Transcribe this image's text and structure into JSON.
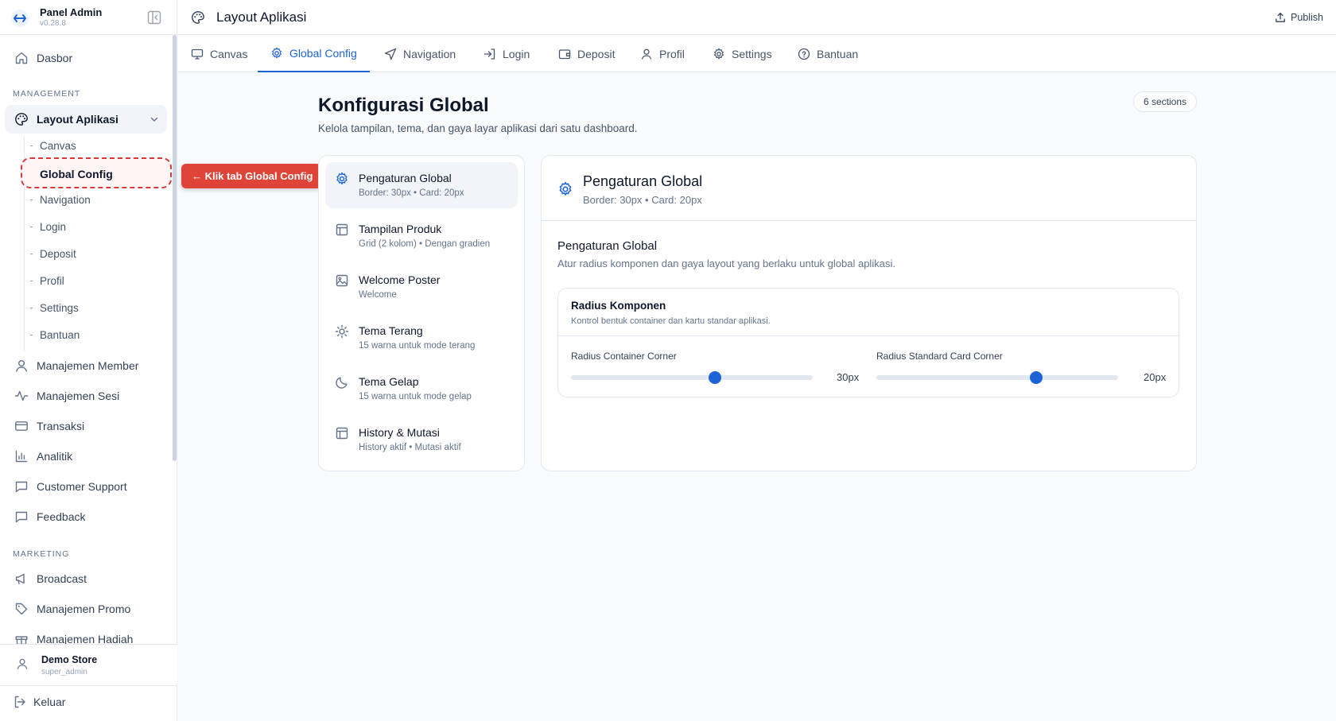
{
  "brand": {
    "name": "Panel Admin",
    "version": "v0.28.8"
  },
  "sidebar": {
    "dashboard": "Dasbor",
    "management_label": "MANAGEMENT",
    "layout_app": "Layout Aplikasi",
    "sub_items": [
      "Canvas",
      "Global Config",
      "Navigation",
      "Login",
      "Deposit",
      "Profil",
      "Settings",
      "Bantuan"
    ],
    "items": [
      "Manajemen Member",
      "Manajemen Sesi",
      "Transaksi",
      "Analitik",
      "Customer Support",
      "Feedback"
    ],
    "marketing_label": "MARKETING",
    "marketing_items": [
      "Broadcast",
      "Manajemen Promo",
      "Manajemen Hadiah"
    ],
    "user": {
      "name": "Demo Store",
      "role": "super_admin"
    },
    "logout": "Keluar"
  },
  "callout": "← Klik tab Global Config",
  "header": {
    "title": "Layout Aplikasi",
    "publish": "Publish"
  },
  "tabs": [
    "Canvas",
    "Global Config",
    "Navigation",
    "Login",
    "Deposit",
    "Profil",
    "Settings",
    "Bantuan"
  ],
  "page": {
    "title": "Konfigurasi Global",
    "subtitle": "Kelola tampilan, tema, dan gaya layar aplikasi dari satu dashboard.",
    "badge": "6 sections"
  },
  "sections": [
    {
      "title": "Pengaturan Global",
      "sub": "Border: 30px • Card: 20px"
    },
    {
      "title": "Tampilan Produk",
      "sub": "Grid (2 kolom) • Dengan gradien"
    },
    {
      "title": "Welcome Poster",
      "sub": "Welcome"
    },
    {
      "title": "Tema Terang",
      "sub": "15 warna untuk mode terang"
    },
    {
      "title": "Tema Gelap",
      "sub": "15 warna untuk mode gelap"
    },
    {
      "title": "History & Mutasi",
      "sub": "History aktif • Mutasi aktif"
    }
  ],
  "detail": {
    "title": "Pengaturan Global",
    "subtitle": "Border: 30px • Card: 20px",
    "section_title": "Pengaturan Global",
    "section_sub": "Atur radius komponen dan gaya layout yang berlaku untuk global aplikasi.",
    "card_title": "Radius Komponen",
    "card_sub": "Kontrol bentuk container dan kartu standar aplikasi.",
    "sliders": [
      {
        "label": "Radius Container Corner",
        "value_text": "30px",
        "fraction": 0.595
      },
      {
        "label": "Radius Standard Card Corner",
        "value_text": "20px",
        "fraction": 0.66
      }
    ]
  },
  "colors": {
    "accent": "#1d63d8",
    "callout": "#e04438"
  }
}
